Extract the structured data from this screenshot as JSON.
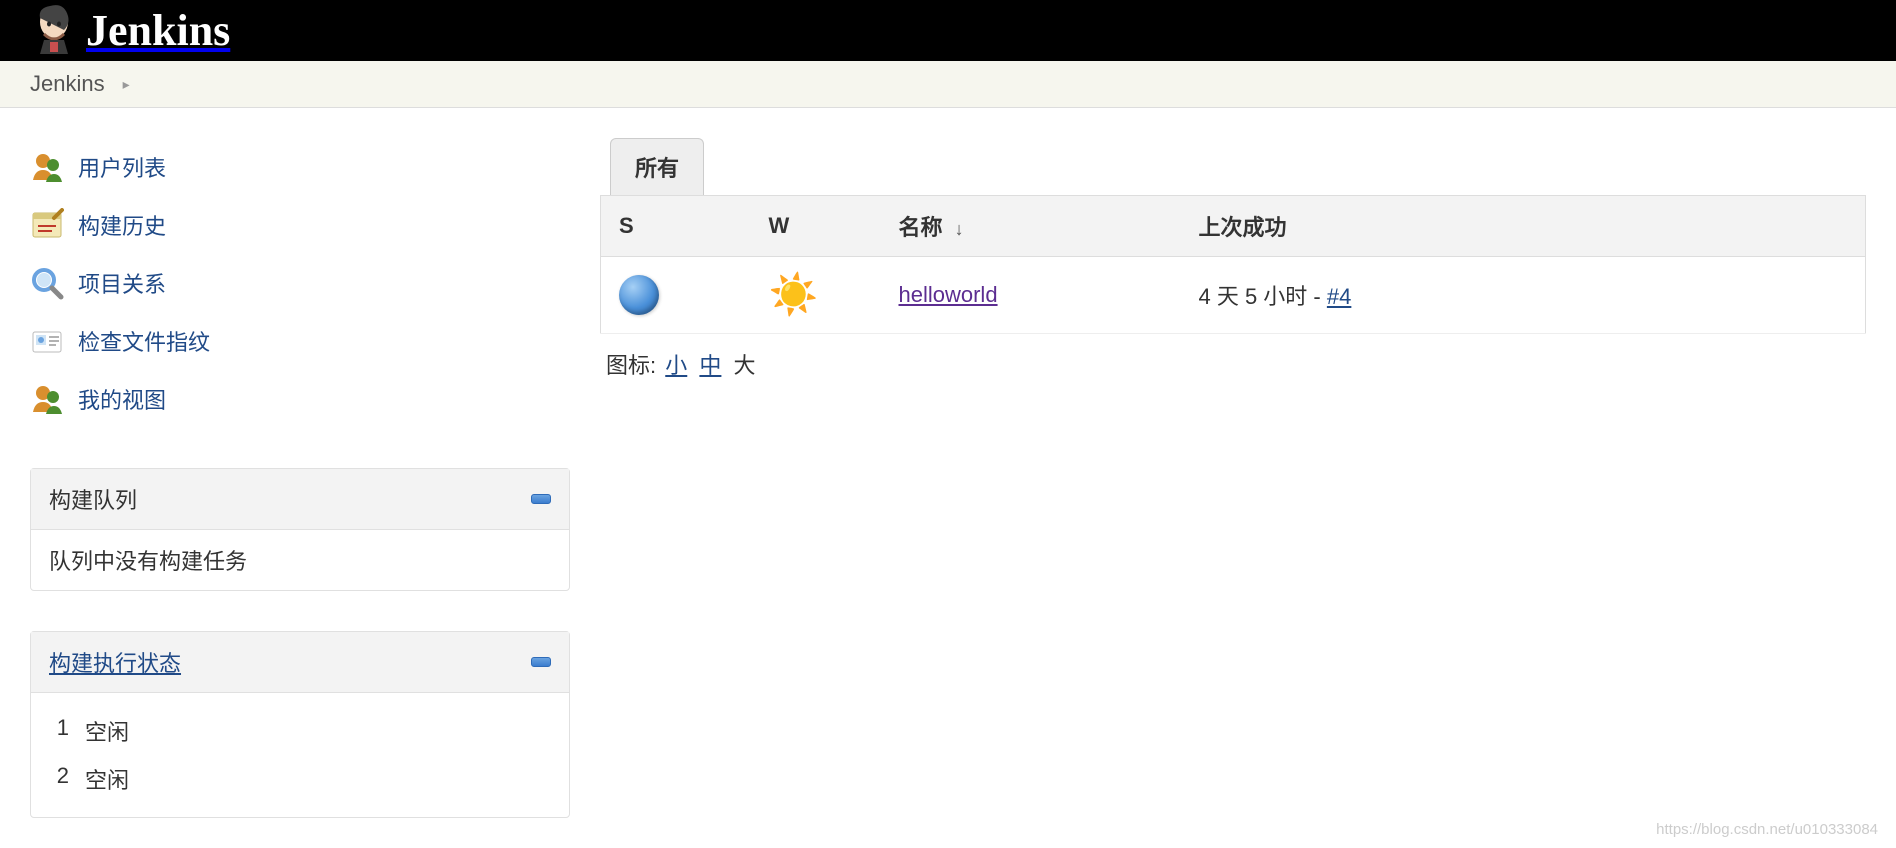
{
  "header": {
    "title": "Jenkins"
  },
  "breadcrumb": {
    "root": "Jenkins"
  },
  "sidebar": {
    "tasks": [
      {
        "label": "用户列表",
        "icon": "users-icon"
      },
      {
        "label": "构建历史",
        "icon": "history-icon"
      },
      {
        "label": "项目关系",
        "icon": "search-icon"
      },
      {
        "label": "检查文件指纹",
        "icon": "fingerprint-icon"
      },
      {
        "label": "我的视图",
        "icon": "users-icon"
      }
    ]
  },
  "build_queue": {
    "title": "构建队列",
    "empty_text": "队列中没有构建任务"
  },
  "executors": {
    "title": "构建执行状态",
    "rows": [
      {
        "num": "1",
        "state": "空闲"
      },
      {
        "num": "2",
        "state": "空闲"
      }
    ]
  },
  "tabs": {
    "all": "所有"
  },
  "table": {
    "headers": {
      "s": "S",
      "w": "W",
      "name": "名称",
      "last_success": "上次成功"
    },
    "sort_indicator": "↓",
    "rows": [
      {
        "status": "blue",
        "weather": "sunny",
        "name": "helloworld",
        "last_success_duration": "4 天 5 小时",
        "last_success_sep": " - ",
        "last_success_build": "#4"
      }
    ]
  },
  "icon_legend": {
    "label": "图标:",
    "small": "小",
    "medium": "中",
    "large": "大"
  },
  "watermark": "https://blog.csdn.net/u010333084"
}
